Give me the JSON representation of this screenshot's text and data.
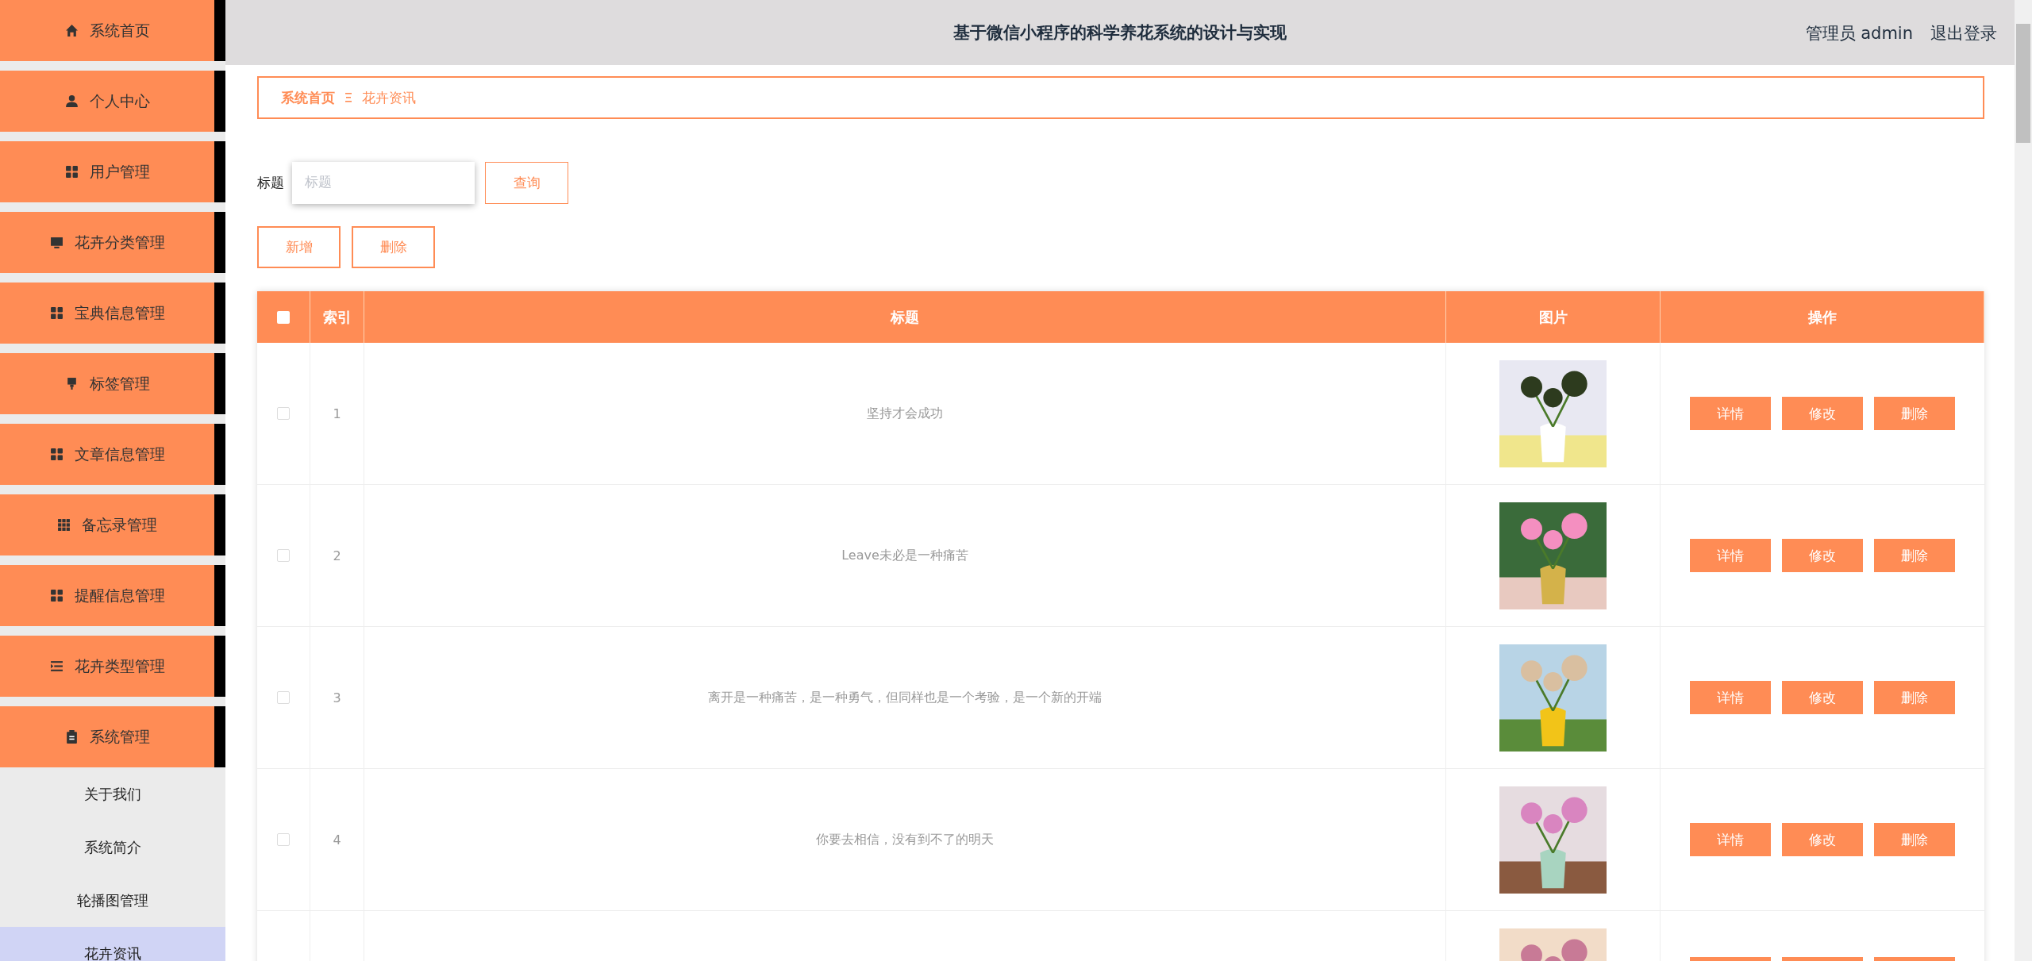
{
  "sidebar": {
    "items": [
      {
        "label": "系统首页",
        "expanded": false
      },
      {
        "label": "个人中心",
        "expanded": false
      },
      {
        "label": "用户管理",
        "expanded": false
      },
      {
        "label": "花卉分类管理",
        "expanded": false
      },
      {
        "label": "宝典信息管理",
        "expanded": false
      },
      {
        "label": "标签管理",
        "expanded": false
      },
      {
        "label": "文章信息管理",
        "expanded": false
      },
      {
        "label": "备忘录管理",
        "expanded": false
      },
      {
        "label": "提醒信息管理",
        "expanded": false
      },
      {
        "label": "花卉类型管理",
        "expanded": false
      },
      {
        "label": "系统管理",
        "expanded": true,
        "children": [
          {
            "label": "关于我们",
            "selected": false
          },
          {
            "label": "系统简介",
            "selected": false
          },
          {
            "label": "轮播图管理",
            "selected": false
          },
          {
            "label": "花卉资讯",
            "selected": true
          }
        ]
      }
    ]
  },
  "header": {
    "title": "基于微信小程序的科学养花系统的设计与实现",
    "user": "管理员 admin",
    "logout": "退出登录"
  },
  "breadcrumb": [
    "系统首页",
    "花卉资讯"
  ],
  "search": {
    "label": "标题",
    "placeholder": "标题",
    "button": "查询"
  },
  "actions": [
    "新增",
    "删除"
  ],
  "table": {
    "select_all_checked": false,
    "columns": [
      "索引",
      "标题",
      "图片",
      "操作"
    ],
    "rows": [
      {
        "kind": "full",
        "index": "1",
        "title": "坚持才会成功",
        "checked": false,
        "buttons": [
          "详情",
          "修改",
          "删除"
        ]
      },
      {
        "kind": "full",
        "index": "2",
        "title": "Leave未必是一种痛苦",
        "checked": false,
        "buttons": [
          "详情",
          "修改",
          "删除"
        ]
      },
      {
        "kind": "full",
        "index": "3",
        "title": "离开是一种痛苦，是一种勇气，但同样也是一个考验，是一个新的开端",
        "checked": false,
        "buttons": [
          "详情",
          "修改",
          "删除"
        ]
      },
      {
        "kind": "full",
        "index": "4",
        "title": "你要去相信，没有到不了的明天",
        "checked": false,
        "buttons": [
          "详情",
          "修改",
          "删除"
        ]
      },
      {
        "kind": "partial"
      }
    ]
  }
}
